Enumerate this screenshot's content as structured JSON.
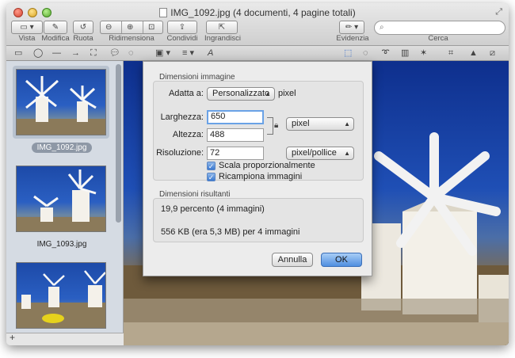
{
  "window": {
    "title": "IMG_1092.jpg (4 documenti, 4 pagine totali)"
  },
  "toolbar": {
    "vista": "Vista",
    "modifica": "Modifica",
    "ruota": "Ruota",
    "ridimensiona": "Ridimensiona",
    "condividi": "Condividi",
    "ingrandisci": "Ingrandisci",
    "evidenzia": "Evidenzia",
    "cerca": "Cerca"
  },
  "sidebar": {
    "items": [
      {
        "caption": "IMG_1092.jpg",
        "selected": true
      },
      {
        "caption": "IMG_1093.jpg",
        "selected": false
      },
      {
        "caption": "",
        "selected": false
      }
    ],
    "add_label": "+"
  },
  "dialog": {
    "section_title": "Dimensioni immagine",
    "fit_label": "Adatta a:",
    "fit_value": "Personalizzato",
    "fit_unit": "pixel",
    "width_label": "Larghezza:",
    "width_value": "650",
    "height_label": "Altezza:",
    "height_value": "488",
    "size_unit": "pixel",
    "resolution_label": "Risoluzione:",
    "resolution_value": "72",
    "resolution_unit": "pixel/pollice",
    "scale_label": "Scala proporzionalmente",
    "resample_label": "Ricampiona immagini",
    "result_title": "Dimensioni risultanti",
    "result_percent": "19,9 percento (4 immagini)",
    "result_size": "556 KB (era 5,3 MB) per 4 immagini",
    "cancel": "Annulla",
    "ok": "OK"
  }
}
